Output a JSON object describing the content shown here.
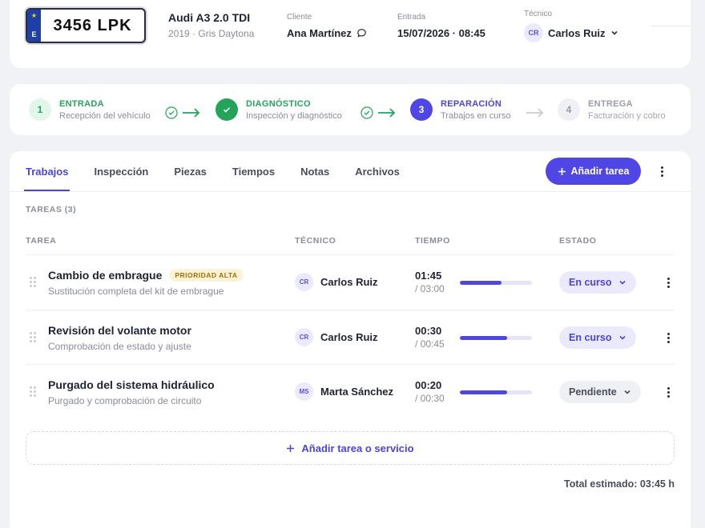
{
  "vehicle": {
    "plate_country": "E",
    "plate_number": "3456 LPK",
    "title": "Audi A3 2.0 TDI",
    "subtitle": "2019 · Gris Daytona"
  },
  "meta": {
    "client_label": "Cliente",
    "client_value": "Ana Martínez",
    "entry_label": "Entrada",
    "entry_value": "15/07/2026 · 08:45",
    "tech_label": "Técnico",
    "tech_initials": "CR",
    "tech_value": "Carlos Ruiz"
  },
  "steps": [
    {
      "num": "1",
      "title": "ENTRADA",
      "sub": "Recepción del vehículo",
      "state": "done"
    },
    {
      "num": "",
      "title": "DIAGNÓSTICO",
      "sub": "Inspección y diagnóstico",
      "state": "done"
    },
    {
      "num": "3",
      "title": "REPARACIÓN",
      "sub": "Trabajos en curso",
      "state": "current"
    },
    {
      "num": "4",
      "title": "ENTREGA",
      "sub": "Facturación y cobro",
      "state": "upcoming"
    }
  ],
  "tabs": [
    "Trabajos",
    "Inspección",
    "Piezas",
    "Tiempos",
    "Notas",
    "Archivos"
  ],
  "add_task_label": "Añadir tarea",
  "section_label": "TAREAS (3)",
  "columns": {
    "task": "TAREA",
    "tech": "TÉCNICO",
    "time": "TIEMPO",
    "status": "ESTADO"
  },
  "tasks": [
    {
      "title": "Cambio de embrague",
      "badge": "PRIORIDAD ALTA",
      "sub": "Sustitución completa del kit de embrague",
      "tech_initials": "CR",
      "tech": "Carlos Ruiz",
      "time": "01:45",
      "total": "/ 03:00",
      "progress": 0.58,
      "status": "En curso",
      "status_type": "active"
    },
    {
      "title": "Revisión del volante motor",
      "badge": "",
      "sub": "Comprobación de estado y ajuste",
      "tech_initials": "CR",
      "tech": "Carlos Ruiz",
      "time": "00:30",
      "total": "/ 00:45",
      "progress": 0.66,
      "status": "En curso",
      "status_type": "active"
    },
    {
      "title": "Purgado del sistema hidráulico",
      "badge": "",
      "sub": "Purgado y comprobación de circuito",
      "tech_initials": "MS",
      "tech": "Marta Sánchez",
      "time": "00:20",
      "total": "/ 00:30",
      "progress": 0.66,
      "status": "Pendiente",
      "status_type": "pending"
    }
  ],
  "add_service_label": "Añadir tarea o servicio",
  "total_label": "Total estimado: 03:45 h",
  "colors": {
    "accent": "#4f46e5",
    "success": "#22a55b",
    "warning_bg": "#fdf3d9"
  }
}
